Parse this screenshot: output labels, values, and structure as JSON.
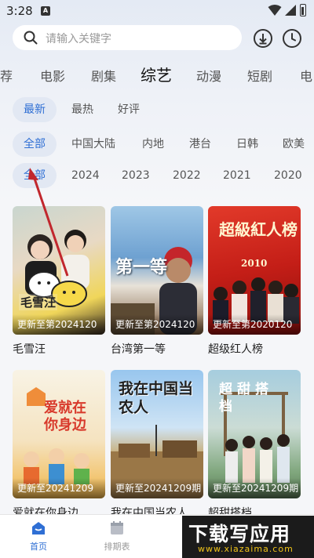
{
  "status": {
    "time": "3:28",
    "app_badge": "A"
  },
  "search": {
    "placeholder": "请输入关键字"
  },
  "categories": [
    "荐",
    "电影",
    "剧集",
    "综艺",
    "动漫",
    "短剧",
    "电"
  ],
  "active_category": "综艺",
  "sort_filters": [
    "最新",
    "最热",
    "好评"
  ],
  "region_filters": [
    "全部",
    "中国大陆",
    "内地",
    "港台",
    "日韩",
    "欧美"
  ],
  "year_filters": [
    "全部",
    "2024",
    "2023",
    "2022",
    "2021",
    "2020"
  ],
  "shows": [
    {
      "title": "毛雪汪",
      "update": "更新至第2024120",
      "art_text": "毛雪汪"
    },
    {
      "title": "台湾第一等",
      "update": "更新至第2024120",
      "art_text": "第一等"
    },
    {
      "title": "超级红人榜",
      "update": "更新至第2020120",
      "art_text": "超級紅人榜",
      "art_year": "2010"
    },
    {
      "title": "爱就在你身边",
      "update": "更新至20241209",
      "art_text": "爱就在你身边"
    },
    {
      "title": "我在中国当农人",
      "update": "更新至20241209期",
      "art_text": "我在中国当农人"
    },
    {
      "title": "超甜搭档",
      "update": "更新至20241209期",
      "art_text": "超甜搭档"
    }
  ],
  "tabs": [
    {
      "label": "首页",
      "icon": "home-icon"
    },
    {
      "label": "排期表",
      "icon": "calendar-icon"
    }
  ],
  "watermark": {
    "big": "下载写应用",
    "small": "www.xiazaima.com"
  },
  "colors": {
    "accent": "#2f6fd4",
    "chip_bg": "#e2e8f3"
  }
}
